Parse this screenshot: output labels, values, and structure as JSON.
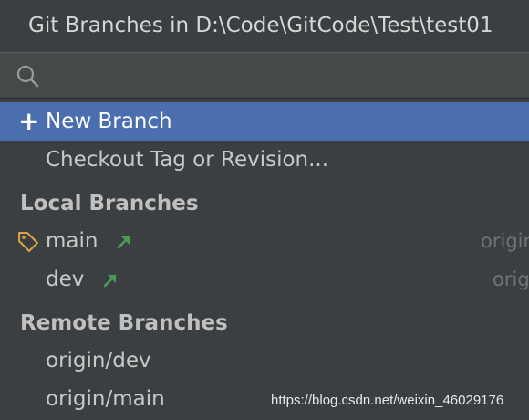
{
  "window": {
    "title": "Git Branches in D:\\Code\\GitCode\\Test\\test01"
  },
  "search": {
    "icon": "search-icon",
    "value": "",
    "placeholder": ""
  },
  "actions": [
    {
      "label": "New Branch",
      "icon": "plus-icon"
    },
    {
      "label": "Checkout Tag or Revision..."
    }
  ],
  "local": {
    "header": "Local Branches",
    "branches": [
      {
        "name": "main",
        "tracking": "origir",
        "current": true,
        "outgoing_icon": "outgoing-arrow-icon"
      },
      {
        "name": "dev",
        "tracking": "origi",
        "current": false,
        "outgoing_icon": "outgoing-arrow-icon"
      }
    ]
  },
  "remote": {
    "header": "Remote Branches",
    "branches": [
      {
        "name": "origin/dev"
      },
      {
        "name": "origin/main"
      }
    ]
  },
  "watermark": "https://blog.csdn.net/weixin_46029176",
  "colors": {
    "background": "#3c3f41",
    "selection": "#4b6eaf",
    "outgoing_arrow": "#499c54",
    "current_tag": "#d9a343"
  }
}
